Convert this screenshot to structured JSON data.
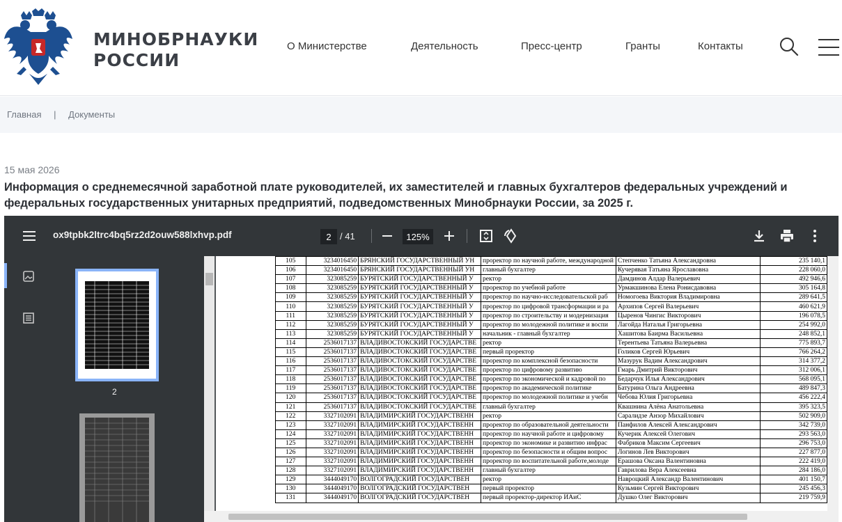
{
  "header": {
    "brand_line1": "МИНОБРНАУКИ",
    "brand_line2": "РОССИИ",
    "nav": [
      "О Министерстве",
      "Деятельность",
      "Пресс-центр",
      "Гранты",
      "Контакты"
    ],
    "icons": {
      "search": "search-icon",
      "menu": "hamburger-menu-icon",
      "logo": "coat-of-arms-emblem"
    }
  },
  "breadcrumb": {
    "home": "Главная",
    "separator": "|",
    "current": "Документы"
  },
  "article": {
    "date": "15 мая 2026",
    "title": "Информация о среднемесячной заработной плате руководителей, их заместителей и главных бухгалтеров федеральных учреждений и федеральных государственных унитарных предприятий, подведомственных Минобрнауки России, за 2025 г."
  },
  "pdf_viewer": {
    "filename": "ox9tpbk2ltrc4bq5rz2d2ouw588lxhvp.pdf",
    "current_page": "2",
    "total_pages": "/ 41",
    "zoom": "125%",
    "thumbnail_label": "2",
    "colors": {
      "toolbar": "#323639",
      "canvas": "#525659",
      "accent": "#8ab4f8"
    }
  },
  "table_rows": [
    [
      "105",
      "3234016450",
      "БРЯНСКИЙ ГОСУДАРСТВЕННЫЙ УН",
      "проректор по научной работе, международной",
      "Степченко Татьяна Александровна",
      "235 140,1"
    ],
    [
      "106",
      "3234016450",
      "БРЯНСКИЙ ГОСУДАРСТВЕННЫЙ УН",
      "главный бухгалтер",
      "Кучерявая Татьяна Ярославовна",
      "228 060,0"
    ],
    [
      "107",
      "323085259",
      "БУРЯТСКИЙ ГОСУДАРСТВЕННЫЙ У",
      "ректор",
      "Дамдинов Алдар Валерьевич",
      "492 946,6"
    ],
    [
      "108",
      "323085259",
      "БУРЯТСКИЙ ГОСУДАРСТВЕННЫЙ У",
      "проректор по учебной работе",
      "Урмакшинова Елена Ронисдавовна",
      "305 164,8"
    ],
    [
      "109",
      "323085259",
      "БУРЯТСКИЙ ГОСУДАРСТВЕННЫЙ У",
      "проректор по научно-исследовательской раб",
      "Номогоева Виктория Владимировна",
      "289 641,5"
    ],
    [
      "110",
      "323085259",
      "БУРЯТСКИЙ ГОСУДАРСТВЕННЫЙ У",
      "проректор по цифровой трансформации и ра",
      "Архипов Сергей Валерьевич",
      "460 621,9"
    ],
    [
      "111",
      "323085259",
      "БУРЯТСКИЙ ГОСУДАРСТВЕННЫЙ У",
      "проректор по строительству и модернизация",
      "Цыренов Чингис Викторович",
      "196 078,5"
    ],
    [
      "112",
      "323085259",
      "БУРЯТСКИЙ ГОСУДАРСТВЕННЫЙ У",
      "проректор по молодежной политике и воспи",
      "Лагойда Наталья Григорьевна",
      "254 992,0"
    ],
    [
      "113",
      "323085259",
      "БУРЯТСКИЙ ГОСУДАРСТВЕННЫЙ У",
      "начальник - главный бухгалтер",
      "Хашитова Баирма Васильевна",
      "248 852,1"
    ],
    [
      "114",
      "2536017137",
      "ВЛАДИВОСТОКСКИЙ ГОСУДАРСТВЕ",
      "ректор",
      "Терентьева Татьяна Валерьевна",
      "775 893,7"
    ],
    [
      "115",
      "2536017137",
      "ВЛАДИВОСТОКСКИЙ ГОСУДАРСТВЕ",
      "первый проректор",
      "Голиков Сергей Юрьевич",
      "766 264,2"
    ],
    [
      "116",
      "2536017137",
      "ВЛАДИВОСТОКСКИЙ ГОСУДАРСТВЕ",
      "проректор по комплексной безопасности",
      "Мазурук Вадим Александрович",
      "314 377,2"
    ],
    [
      "117",
      "2536017137",
      "ВЛАДИВОСТОКСКИЙ ГОСУДАРСТВЕ",
      "проректор по цифровому развитию",
      "Гмарь Дмитрий Викторович",
      "312 006,1"
    ],
    [
      "118",
      "2536017137",
      "ВЛАДИВОСТОКСКИЙ ГОСУДАРСТВЕ",
      "проректор по экономической и кадровой по",
      "Бедарчук Илья Александрович",
      "568 095,1"
    ],
    [
      "119",
      "2536017137",
      "ВЛАДИВОСТОКСКИЙ ГОСУДАРСТВЕ",
      "проректор по академической политике",
      "Батурина Ольга Андреевна",
      "489 847,3"
    ],
    [
      "120",
      "2536017137",
      "ВЛАДИВОСТОКСКИЙ ГОСУДАРСТВЕ",
      "проректор по молодежной политике и учебн",
      "Чебова Юлия Григорьевна",
      "456 222,4"
    ],
    [
      "121",
      "2536017137",
      "ВЛАДИВОСТОКСКИЙ ГОСУДАРСТВЕ",
      "главный бухгалтер",
      "Квашнина Алёна Анатольевна",
      "395 323,5"
    ],
    [
      "122",
      "3327102091",
      "ВЛАДИМИРСКИЙ ГОСУДАРСТВЕНН",
      "ректор",
      "Саралидзе Анзор Михайлович",
      "502 909,0"
    ],
    [
      "123",
      "3327102091",
      "ВЛАДИМИРСКИЙ ГОСУДАРСТВЕНН",
      "проректор по образовательной деятельности",
      "Панфилов Алексей Александрович",
      "342 739,0"
    ],
    [
      "124",
      "3327102091",
      "ВЛАДИМИРСКИЙ ГОСУДАРСТВЕНН",
      "проректор по научной работе и цифровому",
      "Кучерик Алексей Олегович",
      "293 563,0"
    ],
    [
      "125",
      "3327102091",
      "ВЛАДИМИРСКИЙ ГОСУДАРСТВЕНН",
      "проректор по экономике и развитию инфрас",
      "Фабриков Максим Сергеевич",
      "296 753,0"
    ],
    [
      "126",
      "3327102091",
      "ВЛАДИМИРСКИЙ ГОСУДАРСТВЕНН",
      "проректор по безопасности и общим вопрос",
      "Логинов Лев Викторович",
      "227 877,0"
    ],
    [
      "127",
      "3327102091",
      "ВЛАДИМИРСКИЙ ГОСУДАРСТВЕНН",
      "проректор по воспитательной работе,молоде",
      "Ерашова Оксана Валентиновна",
      "222 419,0"
    ],
    [
      "128",
      "3327102091",
      "ВЛАДИМИРСКИЙ ГОСУДАРСТВЕНН",
      "главный бухгалтер",
      "Гаврилова Вера Алексеевна",
      "284 186,0"
    ],
    [
      "129",
      "3444049170",
      "ВОЛГОГРАДСКИЙ ГОСУДАРСТВЕН",
      "ректор",
      "Навроцкий Александр Валентинович",
      "401 150,7"
    ],
    [
      "130",
      "3444049170",
      "ВОЛГОГРАДСКИЙ ГОСУДАРСТВЕН",
      "первый проректор",
      "Кузьмин Сергей Викторович",
      "245 456,3"
    ],
    [
      "131",
      "3444049170",
      "ВОЛГОГРАДСКИЙ ГОСУДАРСТВЕН",
      "первый проректор-директор ИАиС",
      "Душко Олег Викторович",
      "219 759,9"
    ]
  ]
}
